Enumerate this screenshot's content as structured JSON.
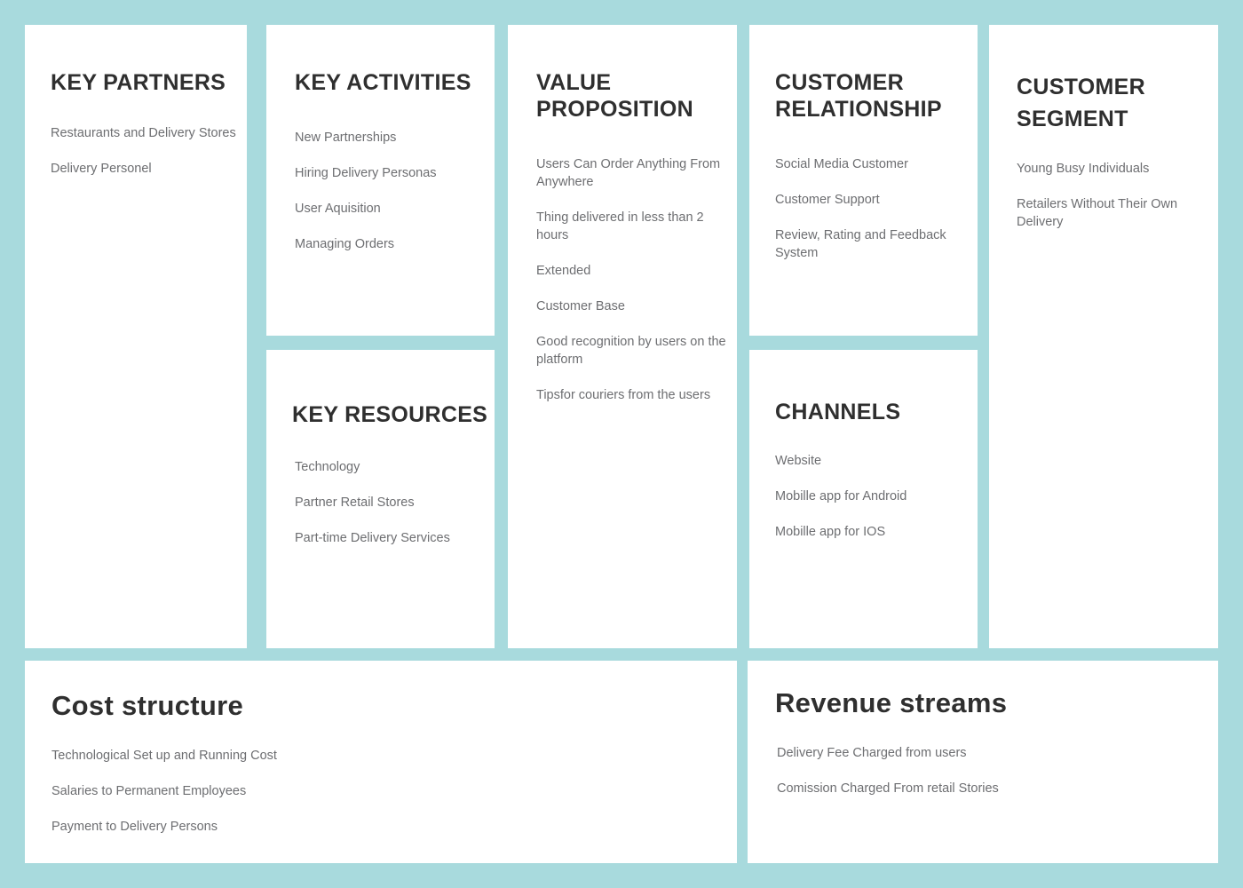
{
  "theme": {
    "background_color": "#a8dadd",
    "card_color": "#ffffff",
    "heading_color": "#2f2f2f",
    "item_text_color": "#6d6e71"
  },
  "blocks": {
    "key_partners": {
      "title": "KEY PARTNERS",
      "items": [
        "Restaurants and Delivery Stores",
        "Delivery Personel"
      ]
    },
    "key_activities": {
      "title": "KEY ACTIVITIES",
      "items": [
        "New Partnerships",
        "Hiring Delivery Personas",
        "User Aquisition",
        "Managing Orders"
      ]
    },
    "key_resources": {
      "title": "KEY RESOURCES",
      "items": [
        "Technology",
        "Partner Retail Stores",
        "Part-time Delivery Services"
      ]
    },
    "value_proposition": {
      "title": "VALUE PROPOSITION",
      "items": [
        "Users Can Order Anything From Anywhere",
        "Thing delivered in less than 2 hours",
        "Extended",
        "Customer Base",
        "Good recognition by users on the platform",
        "Tipsfor couriers from the users"
      ]
    },
    "customer_relationship": {
      "title": "CUSTOMER RELATIONSHIP",
      "items": [
        "Social Media Customer",
        "Customer Support",
        "Review, Rating and Feedback System"
      ]
    },
    "channels": {
      "title": "CHANNELS",
      "items": [
        "Website",
        "Mobille app for Android",
        "Mobille app for IOS"
      ]
    },
    "customer_segment": {
      "title": "CUSTOMER SEGMENT",
      "items": [
        "Young Busy Individuals",
        "Retailers Without Their Own Delivery"
      ]
    },
    "cost_structure": {
      "title": "Cost structure",
      "items": [
        "Technological Set up and Running Cost",
        "Salaries to Permanent Employees",
        "Payment to Delivery Persons"
      ]
    },
    "revenue_streams": {
      "title": "Revenue streams",
      "items": [
        "Delivery Fee Charged from users",
        "Comission Charged From retail Stories"
      ]
    }
  }
}
